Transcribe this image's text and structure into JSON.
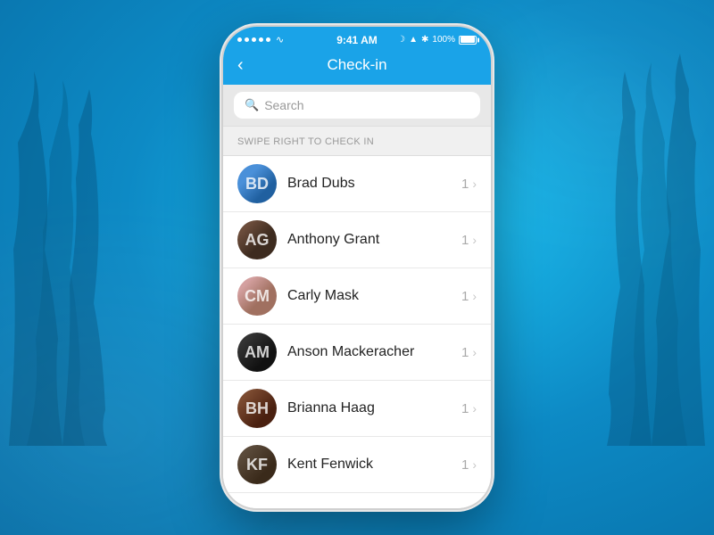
{
  "background": {
    "color": "#1aa3e8"
  },
  "statusBar": {
    "time": "9:41 AM",
    "battery": "100%",
    "signals": [
      "●",
      "●",
      "●",
      "●",
      "●"
    ]
  },
  "navBar": {
    "backLabel": "‹",
    "title": "Check-in"
  },
  "search": {
    "placeholder": "Search"
  },
  "sectionHeader": {
    "label": "SWIPE RIGHT TO CHECK IN"
  },
  "people": [
    {
      "id": 1,
      "name": "Brad Dubs",
      "count": "1",
      "avatarClass": "avatar-1",
      "initials": "BD"
    },
    {
      "id": 2,
      "name": "Anthony Grant",
      "count": "1",
      "avatarClass": "avatar-2",
      "initials": "AG"
    },
    {
      "id": 3,
      "name": "Carly Mask",
      "count": "1",
      "avatarClass": "avatar-3",
      "initials": "CM"
    },
    {
      "id": 4,
      "name": "Anson Mackeracher",
      "count": "1",
      "avatarClass": "avatar-4",
      "initials": "AM"
    },
    {
      "id": 5,
      "name": "Brianna Haag",
      "count": "1",
      "avatarClass": "avatar-5",
      "initials": "BH"
    },
    {
      "id": 6,
      "name": "Kent Fenwick",
      "count": "1",
      "avatarClass": "avatar-6",
      "initials": "KF"
    }
  ]
}
